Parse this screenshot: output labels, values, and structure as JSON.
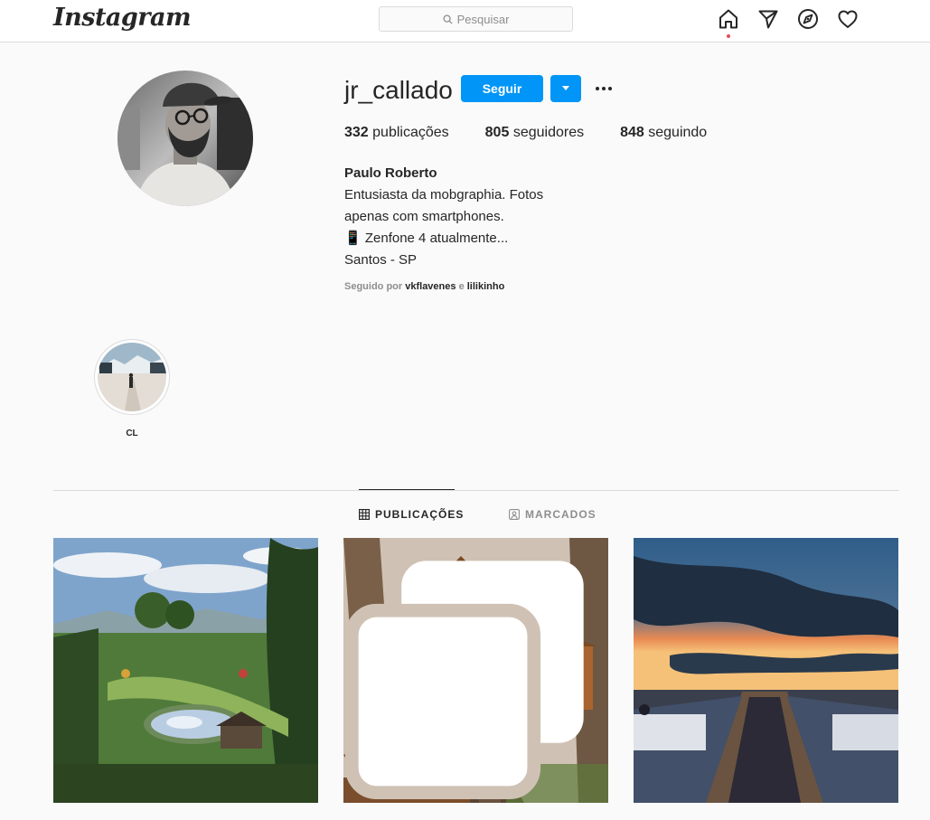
{
  "header": {
    "logo": "Instagram",
    "search": {
      "placeholder": "Pesquisar"
    },
    "nav_icons": [
      "home-icon",
      "direct-icon",
      "explore-icon",
      "activity-icon"
    ]
  },
  "profile": {
    "username": "jr_callado",
    "follow_label": "Seguir",
    "posts_count": "332",
    "posts_label": "publicações",
    "followers_count": "805",
    "followers_label": "seguidores",
    "following_count": "848",
    "following_label": "seguindo",
    "full_name": "Paulo Roberto",
    "bio_lines": [
      "Entusiasta da mobgraphia. Fotos",
      "apenas com smartphones.",
      "📱 Zenfone 4 atualmente...",
      "Santos - SP"
    ],
    "followed_by": {
      "prefix": "Seguido por",
      "accounts": [
        "vkflavenes",
        "lilikinho"
      ],
      "joiner": "e"
    }
  },
  "highlights": [
    {
      "label": "CL"
    }
  ],
  "tabs": [
    {
      "label": "PUBLICAÇÕES",
      "icon": "grid-icon",
      "active": true
    },
    {
      "label": "MARCADOS",
      "icon": "tagged-icon",
      "active": false
    }
  ],
  "posts": [
    {
      "subject": "garden landscape with pond",
      "multiple": false
    },
    {
      "subject": "treehouse",
      "multiple": true
    },
    {
      "subject": "pier at sunset",
      "multiple": false
    }
  ],
  "colors": {
    "accent": "#0095f6",
    "border": "#dbdbdb",
    "muted": "#8e8e8e",
    "notification": "#ed4956"
  }
}
